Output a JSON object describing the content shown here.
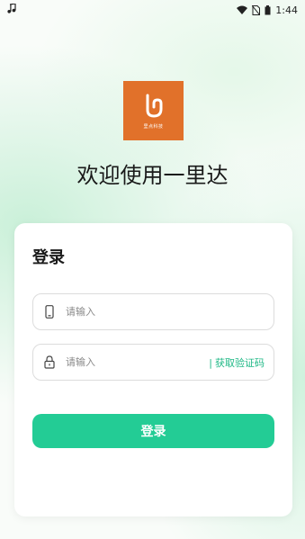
{
  "status_bar": {
    "time": "1:44",
    "icons": [
      "music-note-icon",
      "wifi-icon",
      "no-sim-icon",
      "battery-icon"
    ]
  },
  "logo": {
    "caption": "里点科技",
    "color": "#e1712a"
  },
  "welcome": {
    "title": "欢迎使用一里达"
  },
  "login_card": {
    "title": "登录",
    "phone_field": {
      "icon": "phone-icon",
      "placeholder": "请输入"
    },
    "code_field": {
      "icon": "lock-icon",
      "placeholder": "请输入",
      "separator": "|",
      "get_code_label": "获取验证码"
    },
    "login_button_label": "登录"
  },
  "colors": {
    "accent": "#23cc95",
    "link": "#1fb886",
    "logo_bg": "#e1712a"
  }
}
